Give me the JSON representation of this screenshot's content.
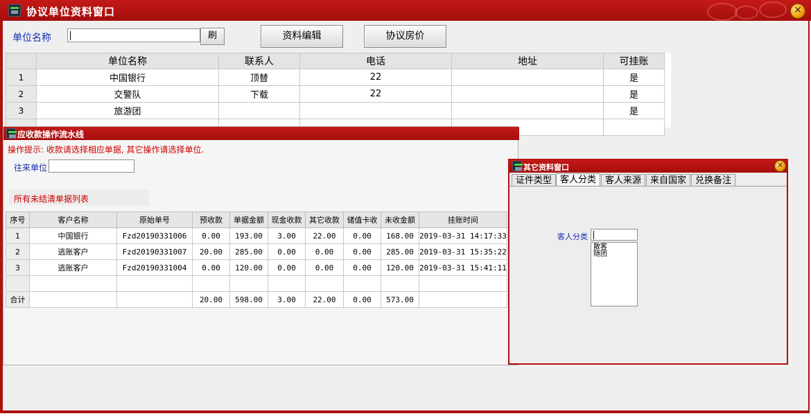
{
  "main_window": {
    "title": "协议单位资料窗口",
    "close_glyph": "✕",
    "search_label": "单位名称",
    "search_value": "",
    "refresh_button": "刷",
    "edit_button": "资料编辑",
    "price_button": "协议房价",
    "table": {
      "headers": [
        "单位名称",
        "联系人",
        "电话",
        "地址",
        "可挂账"
      ],
      "rows": [
        {
          "num": "1",
          "name": "中国银行",
          "contact": "顶替",
          "phone": "22",
          "address": "",
          "credit": "是"
        },
        {
          "num": "2",
          "name": "交警队",
          "contact": "下载",
          "phone": "22",
          "address": "",
          "credit": "是"
        },
        {
          "num": "3",
          "name": "旅游团",
          "contact": "",
          "phone": "",
          "address": "",
          "credit": "是"
        }
      ]
    }
  },
  "receivable_window": {
    "title": "应收款操作流水线",
    "hint": "操作提示: 收款请选择相应单据, 其它操作请选择单位.",
    "partner_label": "往来单位",
    "partner_value": "",
    "list_label": "所有未结清单据列表",
    "headers": [
      "序号",
      "客户名称",
      "原始单号",
      "预收款",
      "单据金额",
      "现金收款",
      "其它收款",
      "储值卡收",
      "未收金额",
      "挂账时间"
    ],
    "rows": [
      {
        "num": "1",
        "customer": "中国银行",
        "order": "Fzd20190331006",
        "prepay": "0.00",
        "amount": "193.00",
        "cash": "3.00",
        "other": "22.00",
        "card": "0.00",
        "unpaid": "168.00",
        "time": "2019-03-31 14:17:33"
      },
      {
        "num": "2",
        "customer": "逃账客户",
        "order": "Fzd20190331007",
        "prepay": "20.00",
        "amount": "285.00",
        "cash": "0.00",
        "other": "0.00",
        "card": "0.00",
        "unpaid": "285.00",
        "time": "2019-03-31 15:35:22"
      },
      {
        "num": "3",
        "customer": "逃账客户",
        "order": "Fzd20190331004",
        "prepay": "0.00",
        "amount": "120.00",
        "cash": "0.00",
        "other": "0.00",
        "card": "0.00",
        "unpaid": "120.00",
        "time": "2019-03-31 15:41:11"
      }
    ],
    "total": {
      "label": "合计",
      "prepay": "20.00",
      "amount": "598.00",
      "cash": "3.00",
      "other": "22.00",
      "card": "0.00",
      "unpaid": "573.00"
    }
  },
  "other_window": {
    "title": "其它资料窗口",
    "close_glyph": "✕",
    "tabs": [
      "证件类型",
      "客人分类",
      "客人来源",
      "来自国家",
      "兑换备注"
    ],
    "active_tab": "客人分类",
    "field_label": "客人分类",
    "field_value": "",
    "list_items": [
      "散客",
      "随团"
    ]
  },
  "colors": {
    "title_red": "#b51412",
    "label_blue": "#1a2fb3",
    "hint_red": "#cc0000"
  }
}
